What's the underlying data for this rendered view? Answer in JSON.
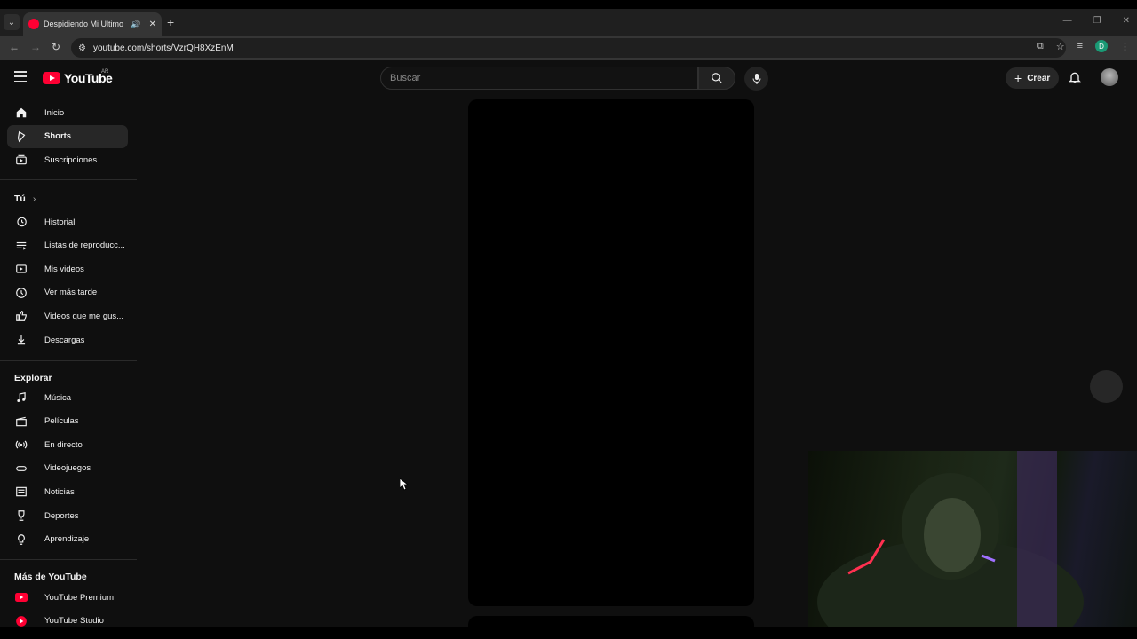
{
  "browser": {
    "tab_title": "Despidiendo Mi Último Culto",
    "url": "youtube.com/shorts/VzrQH8XzEnM",
    "profile_initial": "D"
  },
  "youtube": {
    "logo_text": "YouTube",
    "country_code": "AR",
    "search_placeholder": "Buscar",
    "create_label": "Crear"
  },
  "sidebar": {
    "main": [
      {
        "label": "Inicio",
        "icon": "home-icon"
      },
      {
        "label": "Shorts",
        "icon": "shorts-icon",
        "active": true
      },
      {
        "label": "Suscripciones",
        "icon": "subscriptions-icon"
      }
    ],
    "you_title": "Tú",
    "you": [
      {
        "label": "Historial",
        "icon": "history-icon"
      },
      {
        "label": "Listas de reproducc...",
        "icon": "playlists-icon"
      },
      {
        "label": "Mis videos",
        "icon": "my-videos-icon"
      },
      {
        "label": "Ver más tarde",
        "icon": "watch-later-icon"
      },
      {
        "label": "Videos que me gus...",
        "icon": "liked-icon"
      },
      {
        "label": "Descargas",
        "icon": "downloads-icon"
      }
    ],
    "explore_title": "Explorar",
    "explore": [
      {
        "label": "Música",
        "icon": "music-icon"
      },
      {
        "label": "Películas",
        "icon": "movies-icon"
      },
      {
        "label": "En directo",
        "icon": "live-icon"
      },
      {
        "label": "Videojuegos",
        "icon": "gaming-icon"
      },
      {
        "label": "Noticias",
        "icon": "news-icon"
      },
      {
        "label": "Deportes",
        "icon": "sports-icon"
      },
      {
        "label": "Aprendizaje",
        "icon": "learning-icon"
      }
    ],
    "more_title": "Más de YouTube",
    "more": [
      {
        "label": "YouTube Premium",
        "icon": "youtube-premium-icon"
      },
      {
        "label": "YouTube Studio",
        "icon": "youtube-studio-icon"
      }
    ]
  },
  "colors": {
    "brand_red": "#ff0033",
    "page_bg": "#0f0f0f",
    "active_item_bg": "#272727"
  }
}
